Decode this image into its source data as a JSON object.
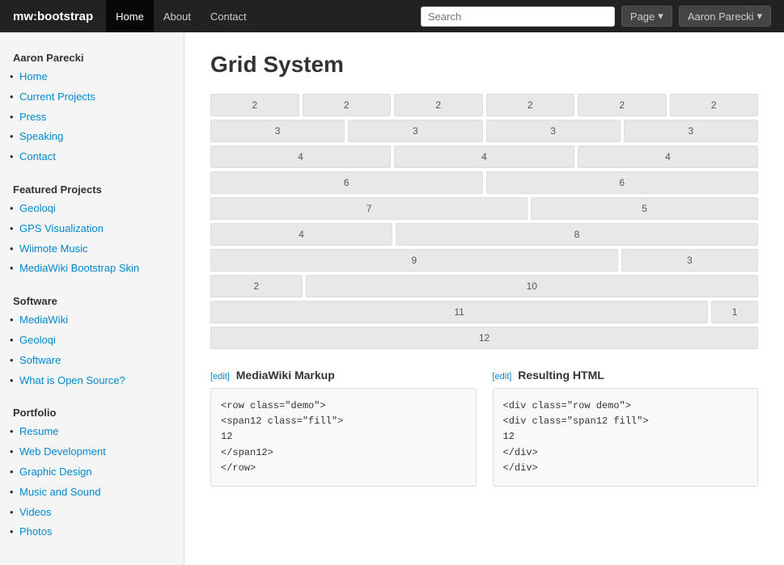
{
  "navbar": {
    "brand": "mw:bootstrap",
    "links": [
      {
        "label": "Home",
        "active": true
      },
      {
        "label": "About",
        "active": false
      },
      {
        "label": "Contact",
        "active": false
      }
    ],
    "search_placeholder": "Search",
    "page_button": "Page",
    "user_button": "Aaron Parecki"
  },
  "sidebar": {
    "sections": [
      {
        "title": "Aaron Parecki",
        "items": [
          "Home",
          "Current Projects",
          "Press",
          "Speaking",
          "Contact"
        ]
      },
      {
        "title": "Featured Projects",
        "items": [
          "Geoloqi",
          "GPS Visualization",
          "Wiimote Music",
          "MediaWiki Bootstrap Skin"
        ]
      },
      {
        "title": "Software",
        "items": [
          "MediaWiki",
          "Geoloqi",
          "Software",
          "What is Open Source?"
        ]
      },
      {
        "title": "Portfolio",
        "items": [
          "Resume",
          "Web Development",
          "Graphic Design",
          "Music and Sound",
          "Videos",
          "Photos"
        ]
      }
    ]
  },
  "main": {
    "title": "Grid System",
    "grid_rows": [
      [
        2,
        2,
        2,
        2,
        2,
        2
      ],
      [
        3,
        3,
        3,
        3
      ],
      [
        4,
        4,
        4
      ],
      [
        6,
        6
      ],
      [
        7,
        5
      ],
      [
        4,
        8
      ],
      [
        9,
        3
      ],
      [
        2,
        10
      ],
      [
        11,
        1
      ],
      [
        12
      ]
    ],
    "code_sections": [
      {
        "title": "MediaWiki Markup",
        "edit_label": "[edit]",
        "code": "<row class=\"demo\">\n<span12 class=\"fill\">\n12\n</span12>\n</row>"
      },
      {
        "title": "Resulting HTML",
        "edit_label": "[edit]",
        "code": "<div class=\"row demo\">\n<div class=\"span12 fill\">\n12\n</div>\n</div>"
      }
    ]
  },
  "icons": {
    "chevron_down": "▾"
  }
}
